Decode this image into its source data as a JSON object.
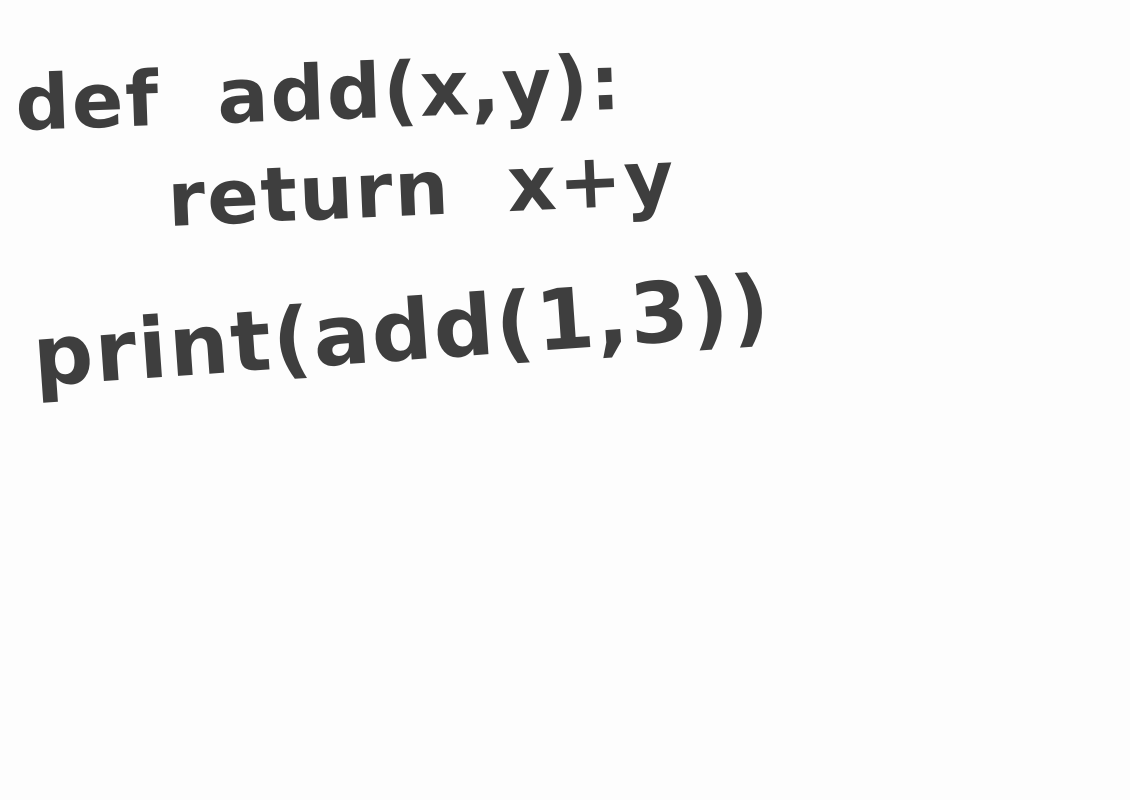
{
  "code": {
    "lines": [
      "def  add(x,y):",
      "return  x+y",
      "print(add(1,3))"
    ]
  },
  "colors": {
    "background": "#fdfdfd",
    "ink": "#3e3e3e"
  }
}
